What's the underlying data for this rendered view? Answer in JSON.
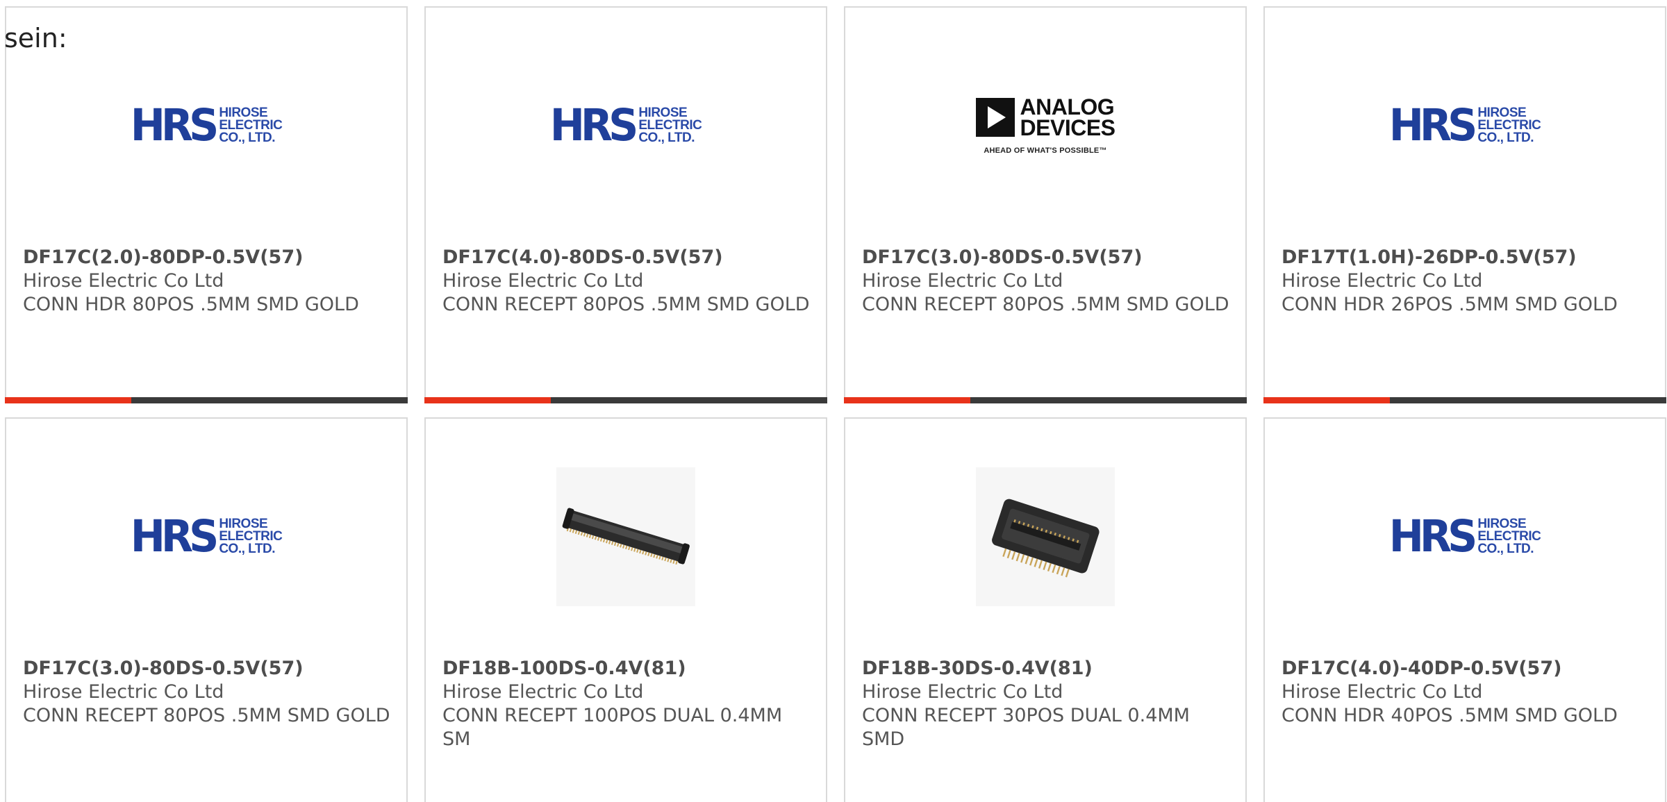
{
  "lead_text": "sein:",
  "cards": [
    {
      "part_number": "DF17C(2.0)-80DP-0.5V(57)",
      "manufacturer": "Hirose Electric Co Ltd",
      "description": "CONN HDR 80POS .5MM SMD GOLD",
      "image": "hirose-logo",
      "has_bar": true
    },
    {
      "part_number": "DF17C(4.0)-80DS-0.5V(57)",
      "manufacturer": "Hirose Electric Co Ltd",
      "description": "CONN RECEPT 80POS .5MM SMD GOLD",
      "image": "hirose-logo",
      "has_bar": true
    },
    {
      "part_number": "DF17C(3.0)-80DS-0.5V(57)",
      "manufacturer": "Hirose Electric Co Ltd",
      "description": "CONN RECEPT 80POS .5MM SMD GOLD",
      "image": "analog-devices-logo",
      "has_bar": true
    },
    {
      "part_number": "DF17T(1.0H)-26DP-0.5V(57)",
      "manufacturer": "Hirose Electric Co Ltd",
      "description": "CONN HDR 26POS .5MM SMD GOLD",
      "image": "hirose-logo",
      "has_bar": true
    },
    {
      "part_number": "DF17C(3.0)-80DS-0.5V(57)",
      "manufacturer": "Hirose Electric Co Ltd",
      "description": "CONN RECEPT 80POS .5MM SMD GOLD",
      "image": "hirose-logo",
      "has_bar": false
    },
    {
      "part_number": "DF18B-100DS-0.4V(81)",
      "manufacturer": "Hirose Electric Co Ltd",
      "description": "CONN RECEPT 100POS DUAL 0.4MM SM",
      "image": "connector-photo-long",
      "has_bar": false
    },
    {
      "part_number": "DF18B-30DS-0.4V(81)",
      "manufacturer": "Hirose Electric Co Ltd",
      "description": "CONN RECEPT 30POS DUAL 0.4MM SMD",
      "image": "connector-photo-short",
      "has_bar": false
    },
    {
      "part_number": "DF17C(4.0)-40DP-0.5V(57)",
      "manufacturer": "Hirose Electric Co Ltd",
      "description": "CONN HDR 40POS .5MM SMD GOLD",
      "image": "hirose-logo",
      "has_bar": false
    }
  ],
  "logos": {
    "hirose": {
      "mark": "HRS",
      "line1": "HIROSE",
      "line2": "ELECTRIC",
      "line3": "CO., LTD."
    },
    "analog_devices": {
      "line1": "ANALOG",
      "line2": "DEVICES",
      "tagline": "AHEAD OF WHAT'S POSSIBLE™"
    }
  },
  "colors": {
    "accent": "#e8321a",
    "bar": "#3a3a3a",
    "border": "#d9d9d9",
    "hirose_blue": "#1f3f9a"
  }
}
